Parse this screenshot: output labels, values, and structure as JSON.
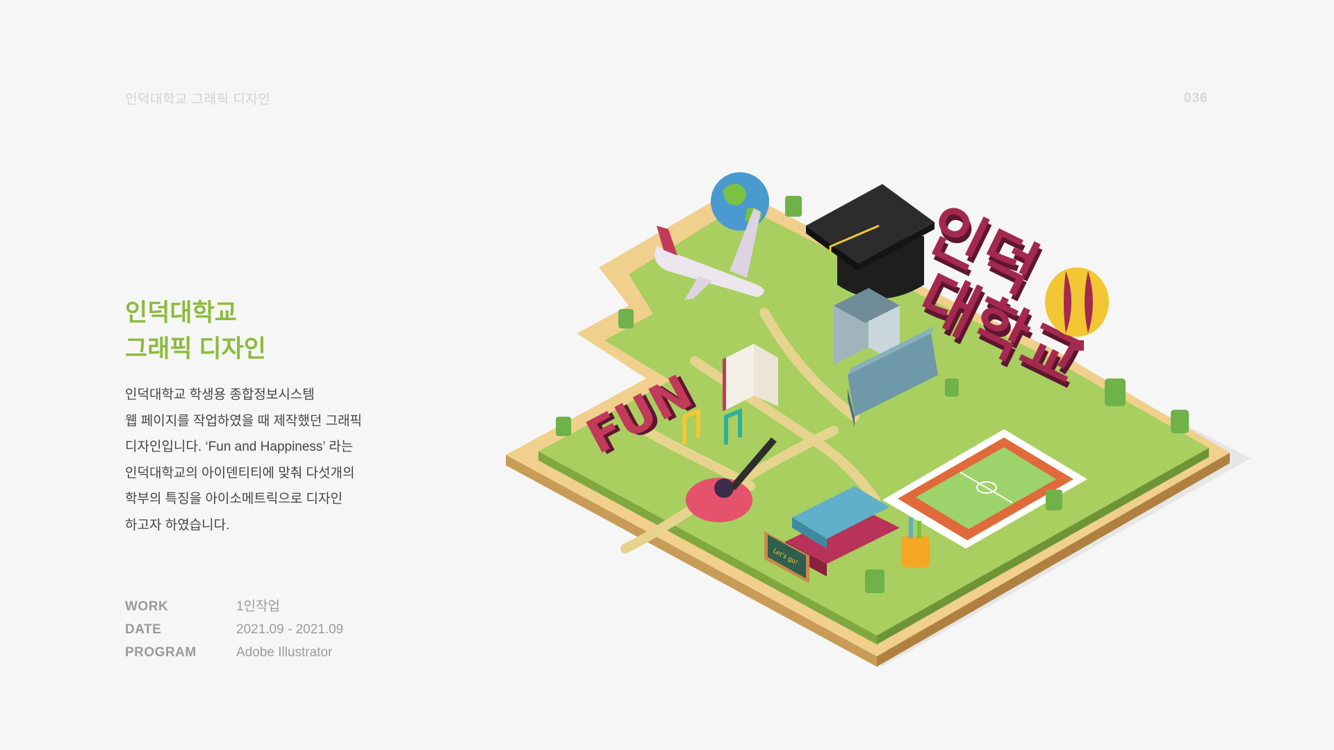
{
  "header": {
    "project_label": "인덕대학교 그래픽 디자인",
    "page_number": "036"
  },
  "main": {
    "title_line1": "인덕대학교",
    "title_line2": "그래픽 디자인",
    "description": [
      "인덕대학교 학생용 종합정보시스템",
      "웹 페이지를 작업하였을 때 제작했던 그래픽",
      "디자인입니다. ‘Fun and Happiness’ 라는",
      "인덕대학교의 아이덴티티에 맞춰 다섯개의",
      "학부의 특징을 아이소메트릭으로 디자인",
      "하고자 하였습니다."
    ]
  },
  "meta": [
    {
      "key": "WORK",
      "value": "1인작업"
    },
    {
      "key": "DATE",
      "value": "2021.09 - 2021.09"
    },
    {
      "key": "PROGRAM",
      "value": "Adobe Illustrator"
    }
  ],
  "illustration": {
    "sign_fun": "FUN",
    "sign_line1": "인덕",
    "sign_line2": "대학교",
    "chalkboard_text": "Let's go!",
    "colors": {
      "grass": "#a8cf5f",
      "sand": "#f0d08c",
      "path": "#e6d48e",
      "sign": "#8a2345",
      "track": "#e06a3a",
      "field": "#9cd36a",
      "accent": "#8dbb3c"
    }
  }
}
